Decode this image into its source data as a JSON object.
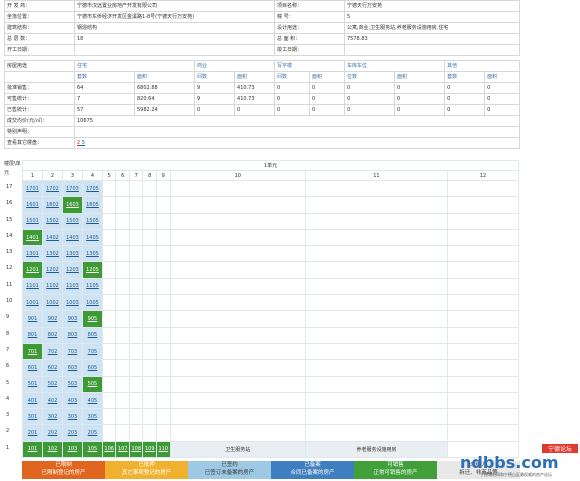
{
  "info": {
    "rows": [
      [
        "开 发 商：",
        "宁德市汉远置业房地产开发有限公司",
        "项目名称：",
        "宁德天行万安苑"
      ],
      [
        "坐落位置：",
        "宁德市东侨经济开发区金溪路1-8号(宁德天行万安苑)",
        "幢 号：",
        "5"
      ],
      [
        "建筑结构：",
        "钢混结构",
        "设计用途：",
        "公寓,商业,卫生服务站,养老服务设施用房,住宅"
      ],
      [
        "总 层 数：",
        "18",
        "总 面 积：",
        "7578.83"
      ],
      [
        "开工日期：",
        "",
        "竣工日期：",
        ""
      ]
    ]
  },
  "usage": {
    "header": [
      "房屋用途",
      "住宅",
      "商业",
      "写字楼",
      "车库车位",
      "其他"
    ],
    "subheader": [
      "套数",
      "面积",
      "间数",
      "面积",
      "间数",
      "面积",
      "位数",
      "面积",
      "套数",
      "面积"
    ],
    "rows": [
      {
        "label": "批准销售：",
        "values": [
          "64",
          "6802.88",
          "9",
          "410.73",
          "0",
          "0",
          "0",
          "0",
          "0",
          "0"
        ]
      },
      {
        "label": "可售统计：",
        "values": [
          "7",
          "820.64",
          "9",
          "410.73",
          "0",
          "0",
          "0",
          "0",
          "0",
          "0"
        ]
      },
      {
        "label": "已售统计：",
        "values": [
          "57",
          "5982.24",
          "0",
          "0",
          "0",
          "0",
          "0",
          "0",
          "0",
          "0"
        ]
      }
    ],
    "avg_price_label": "成交均价(元/㎡)：",
    "avg_price_value": "10675",
    "notes_label": "特别声明：",
    "other_label": "查看其它楼盘：",
    "other_value_a": "2",
    "other_value_b": "5"
  },
  "grid": {
    "floor_header": "楼层\\单元",
    "unit_header": "1单元",
    "columns": [
      "1",
      "2",
      "3",
      "4",
      "5",
      "6",
      "7",
      "8",
      "9",
      "10",
      "11",
      "12"
    ],
    "floors": [
      {
        "floor": "17",
        "rooms": [
          "1701",
          "1702",
          "1703",
          "1705"
        ],
        "sold": []
      },
      {
        "floor": "16",
        "rooms": [
          "1601",
          "1602",
          "1603",
          "1605"
        ],
        "sold": [
          2
        ]
      },
      {
        "floor": "15",
        "rooms": [
          "1501",
          "1502",
          "1503",
          "1505"
        ],
        "sold": []
      },
      {
        "floor": "14",
        "rooms": [
          "1401",
          "1402",
          "1403",
          "1405"
        ],
        "sold": [
          0
        ]
      },
      {
        "floor": "13",
        "rooms": [
          "1301",
          "1302",
          "1303",
          "1305"
        ],
        "sold": []
      },
      {
        "floor": "12",
        "rooms": [
          "1201",
          "1202",
          "1203",
          "1205"
        ],
        "sold": [
          0,
          3
        ]
      },
      {
        "floor": "11",
        "rooms": [
          "1101",
          "1102",
          "1103",
          "1105"
        ],
        "sold": []
      },
      {
        "floor": "10",
        "rooms": [
          "1001",
          "1002",
          "1003",
          "1005"
        ],
        "sold": []
      },
      {
        "floor": "9",
        "rooms": [
          "901",
          "902",
          "903",
          "905"
        ],
        "sold": [
          3
        ]
      },
      {
        "floor": "8",
        "rooms": [
          "801",
          "802",
          "803",
          "805"
        ],
        "sold": []
      },
      {
        "floor": "7",
        "rooms": [
          "701",
          "702",
          "703",
          "705"
        ],
        "sold": [
          0
        ]
      },
      {
        "floor": "6",
        "rooms": [
          "601",
          "602",
          "603",
          "605"
        ],
        "sold": []
      },
      {
        "floor": "5",
        "rooms": [
          "501",
          "502",
          "503",
          "505"
        ],
        "sold": [
          3
        ]
      },
      {
        "floor": "4",
        "rooms": [
          "401",
          "402",
          "403",
          "405"
        ],
        "sold": []
      },
      {
        "floor": "3",
        "rooms": [
          "301",
          "302",
          "303",
          "305"
        ],
        "sold": []
      },
      {
        "floor": "2",
        "rooms": [
          "201",
          "202",
          "203",
          "205"
        ],
        "sold": []
      }
    ],
    "ground": {
      "floor": "1",
      "rooms": [
        "101",
        "102",
        "103",
        "105",
        "106",
        "107",
        "108",
        "109",
        "110"
      ],
      "shop1": "卫生服务站",
      "shop2": "养老服务设施用房"
    }
  },
  "legend": [
    {
      "title": "已限制",
      "sub": "已限制登记的房产",
      "color": "#e0661f"
    },
    {
      "title": "已抵押",
      "sub": "其它事项登记的房产",
      "color": "#f0b22e"
    },
    {
      "title": "已签约",
      "sub": "已签订未备案的房产",
      "color": "#9ec9e4"
    },
    {
      "title": "已备案",
      "sub": "合同已备案的房产",
      "color": "#3f7fbf"
    },
    {
      "title": "可销售",
      "sub": "正常可销售的房产",
      "color": "#41a03a"
    },
    {
      "title": "未纳入",
      "sub": "拆迁、非商品等",
      "color": "#e8e8e8"
    }
  ],
  "watermark": "ndbbs.com",
  "watermark_badge": "宁德论坛",
  "watermark_slogan": "宁德城地网和宁德山区最权威的房产论坛"
}
